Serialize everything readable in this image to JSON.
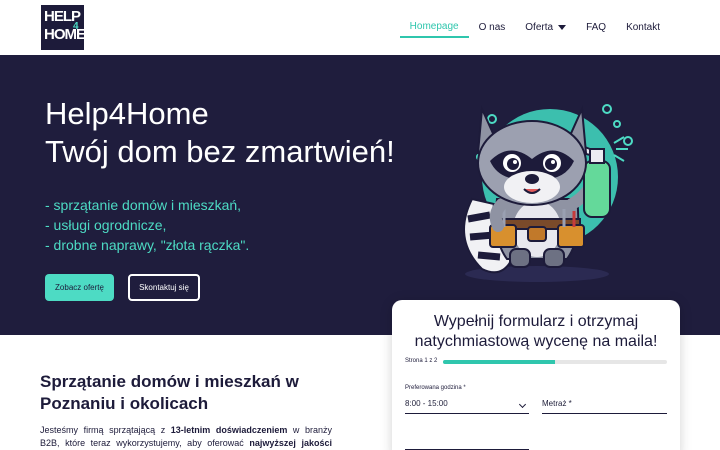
{
  "brand": {
    "logo_line1": "HELP",
    "logo_line2": "HOME",
    "logo_digit": "4"
  },
  "nav": {
    "items": [
      {
        "label": "Homepage",
        "active": true
      },
      {
        "label": "O nas"
      },
      {
        "label": "Oferta",
        "has_dropdown": true
      },
      {
        "label": "FAQ"
      },
      {
        "label": "Kontakt"
      }
    ]
  },
  "hero": {
    "title_line1": "Help4Home",
    "title_line2": "Twój dom bez zmartwień!",
    "list": [
      "- sprzątanie domów i mieszkań,",
      "- usługi ogrodnicze,",
      "- drobne naprawy, \"złota rączka\"."
    ],
    "btn_offer": "Zobacz ofertę",
    "btn_contact": "Skontaktuj się"
  },
  "form": {
    "title": "Wypełnij formularz i otrzymaj natychmiastową wycenę na maila!",
    "step_label": "Strona 1 z 2",
    "progress": 0.5,
    "hour_label": "Preferowana godzina *",
    "hour_value": "8:00 - 15:00",
    "area_placeholder": "Metraż *"
  },
  "content": {
    "section_title": "Sprzątanie domów i mieszkań w Poznaniu i okolicach",
    "para_part1": "Jesteśmy firmą sprzątającą z ",
    "para_bold1": "13-letnim doświadczeniem",
    "para_part2": " w branży B2B, które teraz wykorzystujemy, aby oferować ",
    "para_bold2": "najwyższej jakości usługi"
  },
  "colors": {
    "navy": "#1f1d3d",
    "accent": "#4ddbc4",
    "accent_dark": "#2fc6ad"
  }
}
